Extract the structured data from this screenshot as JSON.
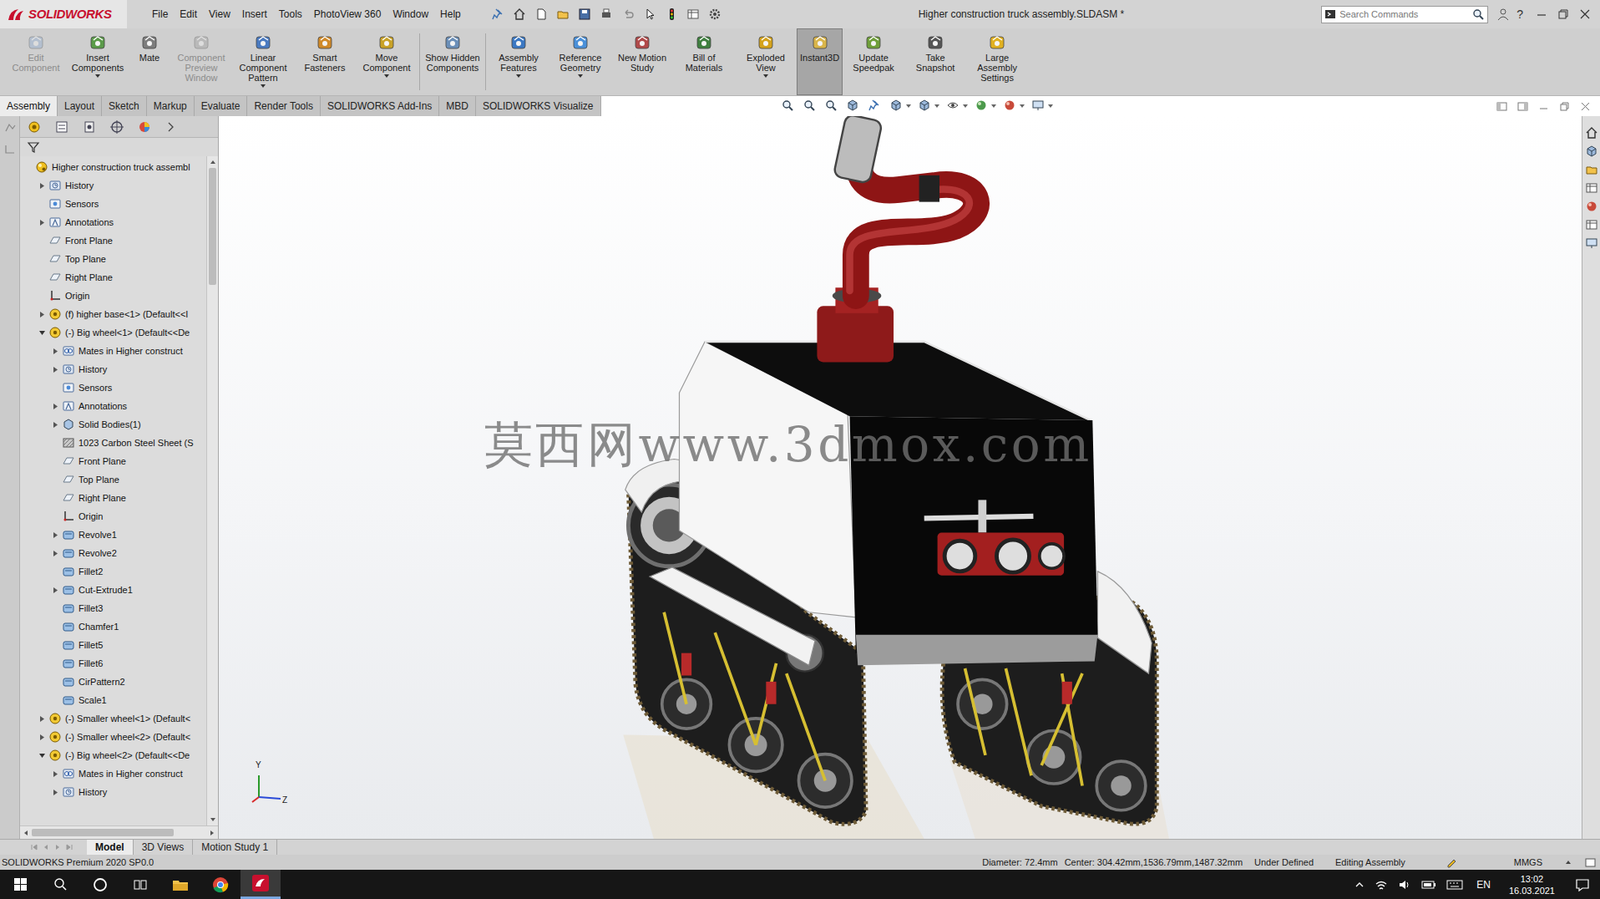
{
  "window": {
    "title": "Higher construction truck assembly.SLDASM *"
  },
  "app": {
    "logo": "SOLIDWORKS"
  },
  "menu": [
    "File",
    "Edit",
    "View",
    "Insert",
    "Tools",
    "PhotoView 360",
    "Window",
    "Help"
  ],
  "search": {
    "placeholder": "Search Commands"
  },
  "help": "?",
  "ribbon": [
    {
      "label": "Edit Component",
      "disabled": true,
      "selected": false,
      "dropdown": false
    },
    {
      "label": "Insert Components",
      "disabled": false,
      "selected": false,
      "dropdown": true
    },
    {
      "label": "Mate",
      "disabled": false,
      "selected": false,
      "dropdown": false
    },
    {
      "label": "Component Preview Window",
      "disabled": true,
      "selected": false,
      "dropdown": false
    },
    {
      "label": "Linear Component Pattern",
      "disabled": false,
      "selected": false,
      "dropdown": true
    },
    {
      "label": "Smart Fasteners",
      "disabled": false,
      "selected": false,
      "dropdown": false
    },
    {
      "label": "Move Component",
      "disabled": false,
      "selected": false,
      "dropdown": true
    },
    {
      "label": "Show Hidden Components",
      "disabled": false,
      "selected": false,
      "dropdown": false
    },
    {
      "label": "Assembly Features",
      "disabled": false,
      "selected": false,
      "dropdown": true
    },
    {
      "label": "Reference Geometry",
      "disabled": false,
      "selected": false,
      "dropdown": true
    },
    {
      "label": "New Motion Study",
      "disabled": false,
      "selected": false,
      "dropdown": false
    },
    {
      "label": "Bill of Materials",
      "disabled": false,
      "selected": false,
      "dropdown": false
    },
    {
      "label": "Exploded View",
      "disabled": false,
      "selected": false,
      "dropdown": true
    },
    {
      "label": "Instant3D",
      "disabled": false,
      "selected": true,
      "dropdown": false
    },
    {
      "label": "Update Speedpak",
      "disabled": false,
      "selected": false,
      "dropdown": false
    },
    {
      "label": "Take Snapshot",
      "disabled": false,
      "selected": false,
      "dropdown": false
    },
    {
      "label": "Large Assembly Settings",
      "disabled": false,
      "selected": false,
      "dropdown": false
    }
  ],
  "tabs": [
    {
      "label": "Assembly",
      "selected": true
    },
    {
      "label": "Layout",
      "selected": false
    },
    {
      "label": "Sketch",
      "selected": false
    },
    {
      "label": "Markup",
      "selected": false
    },
    {
      "label": "Evaluate",
      "selected": false
    },
    {
      "label": "Render Tools",
      "selected": false
    },
    {
      "label": "SOLIDWORKS Add-Ins",
      "selected": false
    },
    {
      "label": "MBD",
      "selected": false
    },
    {
      "label": "SOLIDWORKS Visualize",
      "selected": false
    }
  ],
  "tree": {
    "items": [
      {
        "label": "Higher construction truck assembl",
        "level": 0,
        "kind": "assembly"
      },
      {
        "label": "History",
        "level": 1,
        "kind": "history",
        "expanded": false
      },
      {
        "label": "Sensors",
        "level": 1,
        "kind": "sensor"
      },
      {
        "label": "Annotations",
        "level": 1,
        "kind": "annotation",
        "expanded": false
      },
      {
        "label": "Front Plane",
        "level": 1,
        "kind": "plane"
      },
      {
        "label": "Top Plane",
        "level": 1,
        "kind": "plane"
      },
      {
        "label": "Right Plane",
        "level": 1,
        "kind": "plane"
      },
      {
        "label": "Origin",
        "level": 1,
        "kind": "origin"
      },
      {
        "label": "(f) higher base<1> (Default<<I",
        "level": 1,
        "kind": "part",
        "expanded": false
      },
      {
        "label": "(-) Big wheel<1> (Default<<De",
        "level": 1,
        "kind": "part",
        "expanded": true
      },
      {
        "label": "Mates in Higher construct",
        "level": 2,
        "kind": "mates",
        "expanded": false
      },
      {
        "label": "History",
        "level": 2,
        "kind": "history",
        "expanded": false
      },
      {
        "label": "Sensors",
        "level": 2,
        "kind": "sensor"
      },
      {
        "label": "Annotations",
        "level": 2,
        "kind": "annotation",
        "expanded": false
      },
      {
        "label": "Solid Bodies(1)",
        "level": 2,
        "kind": "bodies",
        "expanded": false
      },
      {
        "label": "1023 Carbon Steel Sheet (S",
        "level": 2,
        "kind": "material"
      },
      {
        "label": "Front Plane",
        "level": 2,
        "kind": "plane"
      },
      {
        "label": "Top Plane",
        "level": 2,
        "kind": "plane"
      },
      {
        "label": "Right Plane",
        "level": 2,
        "kind": "plane"
      },
      {
        "label": "Origin",
        "level": 2,
        "kind": "origin"
      },
      {
        "label": "Revolve1",
        "level": 2,
        "kind": "feature",
        "expanded": false
      },
      {
        "label": "Revolve2",
        "level": 2,
        "kind": "feature",
        "expanded": false
      },
      {
        "label": "Fillet2",
        "level": 2,
        "kind": "feature"
      },
      {
        "label": "Cut-Extrude1",
        "level": 2,
        "kind": "feature",
        "expanded": false
      },
      {
        "label": "Fillet3",
        "level": 2,
        "kind": "feature"
      },
      {
        "label": "Chamfer1",
        "level": 2,
        "kind": "feature"
      },
      {
        "label": "Fillet5",
        "level": 2,
        "kind": "feature"
      },
      {
        "label": "Fillet6",
        "level": 2,
        "kind": "feature"
      },
      {
        "label": "CirPattern2",
        "level": 2,
        "kind": "feature"
      },
      {
        "label": "Scale1",
        "level": 2,
        "kind": "feature"
      },
      {
        "label": "(-) Smaller wheel<1> (Default<",
        "level": 1,
        "kind": "part",
        "expanded": false
      },
      {
        "label": "(-) Smaller wheel<2> (Default<",
        "level": 1,
        "kind": "part",
        "expanded": false
      },
      {
        "label": "(-) Big wheel<2> (Default<<De",
        "level": 1,
        "kind": "part",
        "expanded": true
      },
      {
        "label": "Mates in Higher construct",
        "level": 2,
        "kind": "mates",
        "expanded": false
      },
      {
        "label": "History",
        "level": 2,
        "kind": "history",
        "expanded": false
      }
    ]
  },
  "watermark": "莫西网www.3dmox.com",
  "triad": {
    "y": "Y",
    "z": "Z"
  },
  "bottom_tabs": [
    {
      "label": "Model",
      "selected": true
    },
    {
      "label": "3D Views",
      "selected": false
    },
    {
      "label": "Motion Study 1",
      "selected": false
    }
  ],
  "status_bar": {
    "product": "SOLIDWORKS Premium 2020 SP0.0",
    "diameter": "Diameter: 72.4mm",
    "center": "Center: 304.42mm,1536.79mm,1487.32mm",
    "state": "Under Defined",
    "mode": "Editing Assembly",
    "units": "MMGS"
  },
  "taskbar": {
    "language": "EN",
    "time": "13:02",
    "date": "16.03.2021"
  }
}
